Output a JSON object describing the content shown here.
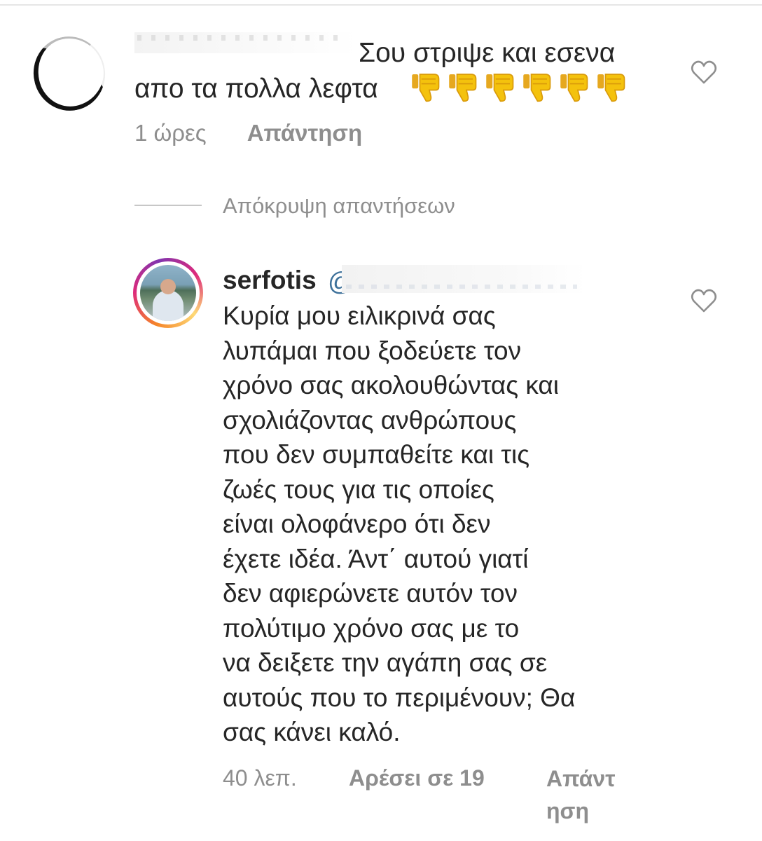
{
  "comments": [
    {
      "username": "",
      "text_line1": "Σου στριψε και εσενα",
      "text_line2": "απο τα πολλα λεφτα",
      "emoji": [
        "👎",
        "👎",
        "👎",
        "👎",
        "👎",
        "👎"
      ],
      "time": "1 ώρες",
      "reply_label": "Απάντηση",
      "like_icon": "heart-outline-icon"
    },
    {
      "username": "serfotis",
      "mention_prefix": "@",
      "body_lines": [
        "Κυρία μου ειλικρινά σας",
        "λυπάμαι που ξοδεύετε τον",
        "χρόνο σας ακολουθώντας και",
        "σχολιάζοντας ανθρώπους",
        "που δεν συμπαθείτε και τις",
        "ζωές τους για τις οποίες",
        "είναι ολοφάνερο ότι δεν",
        "έχετε ιδέα. Άντ΄ αυτού γιατί",
        "δεν αφιερώνετε αυτόν τον",
        "πολύτιμο χρόνο σας με το",
        "να δειξετε την αγάπη σας σε",
        "αυτούς που το περιμένουν; Θα",
        "σας κάνει καλό."
      ],
      "time": "40 λεπ.",
      "likes_label": "Αρέσει σε 19",
      "reply_label_part1": "Απάντ",
      "reply_label_part2": "ηση",
      "like_icon": "heart-outline-icon"
    }
  ],
  "hide_replies_label": "Απόκρυψη απαντήσεων",
  "colors": {
    "text": "#262626",
    "muted": "#8e8e8e",
    "divider": "#c7c7c7",
    "story_ring": [
      "#f58529",
      "#dd2a7b",
      "#8134af",
      "#feda77"
    ]
  }
}
